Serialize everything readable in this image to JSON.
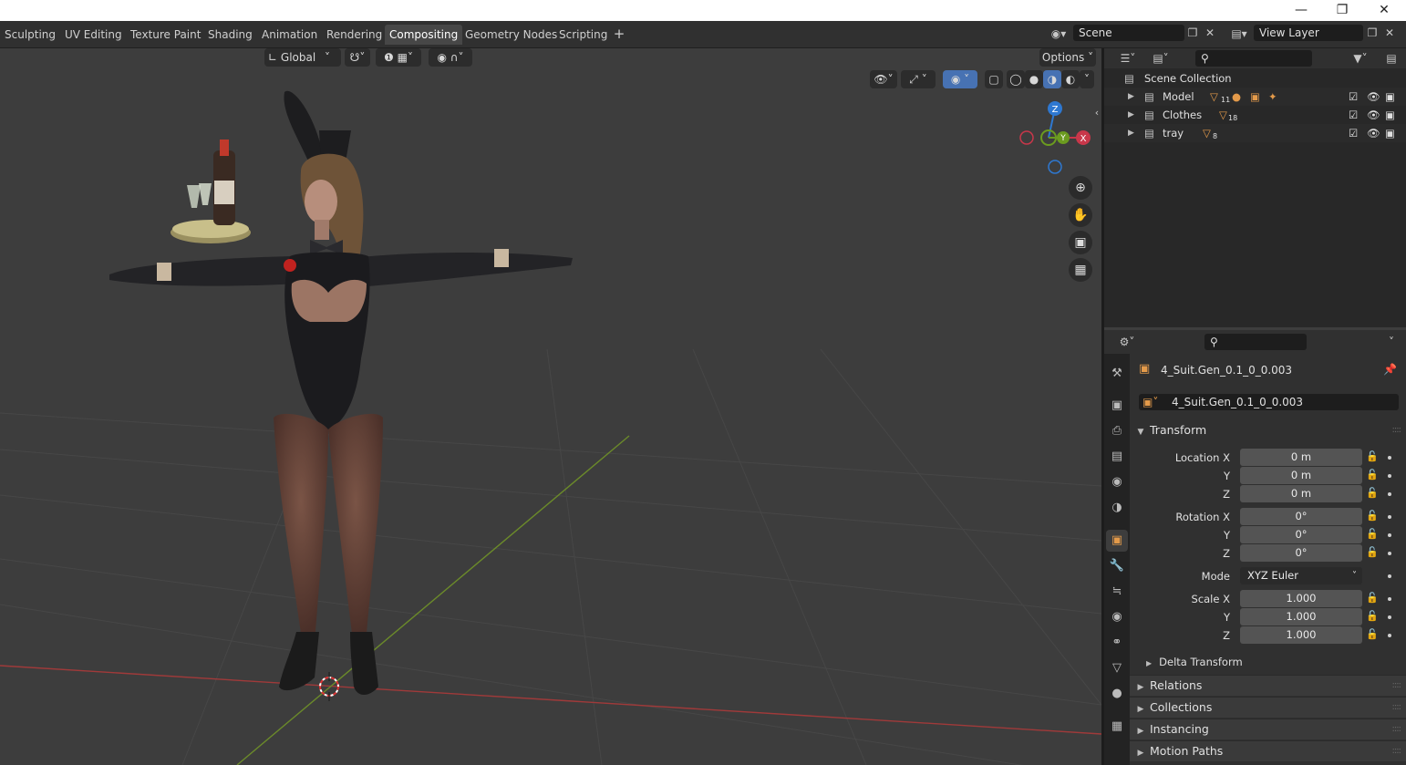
{
  "tabs": [
    "Sculpting",
    "UV Editing",
    "Texture Paint",
    "Shading",
    "Animation",
    "Rendering",
    "Compositing",
    "Geometry Nodes",
    "Scripting"
  ],
  "active_tab": "Compositing",
  "scene_field": "Scene",
  "view_layer_field": "View Layer",
  "viewport": {
    "orientation": "Global",
    "options_label": "Options",
    "gizmo_axes": {
      "z": "Z",
      "y": "Y",
      "x": "X"
    }
  },
  "outliner": {
    "root": "Scene Collection",
    "collections": [
      {
        "name": "Model",
        "count": "11"
      },
      {
        "name": "Clothes",
        "count": "18"
      },
      {
        "name": "tray",
        "count": "8"
      }
    ]
  },
  "properties": {
    "object_name": "4_Suit.Gen_0.1_0_0.003",
    "mesh_name": "4_Suit.Gen_0.1_0_0.003",
    "transform_label": "Transform",
    "location_label": "Location X",
    "rotation_label": "Rotation X",
    "scale_label": "Scale X",
    "axis_y": "Y",
    "axis_z": "Z",
    "location": [
      "0 m",
      "0 m",
      "0 m"
    ],
    "rotation": [
      "0°",
      "0°",
      "0°"
    ],
    "mode_label": "Mode",
    "mode_value": "XYZ Euler",
    "scale": [
      "1.000",
      "1.000",
      "1.000"
    ],
    "delta_transform": "Delta Transform",
    "panels": [
      "Relations",
      "Collections",
      "Instancing",
      "Motion Paths"
    ]
  },
  "colors": {
    "accent": "#4772b3",
    "x_axis": "#c8374a",
    "y_axis": "#6b9b1f",
    "z_axis": "#2e78d1",
    "object_orange": "#e39a4a"
  }
}
